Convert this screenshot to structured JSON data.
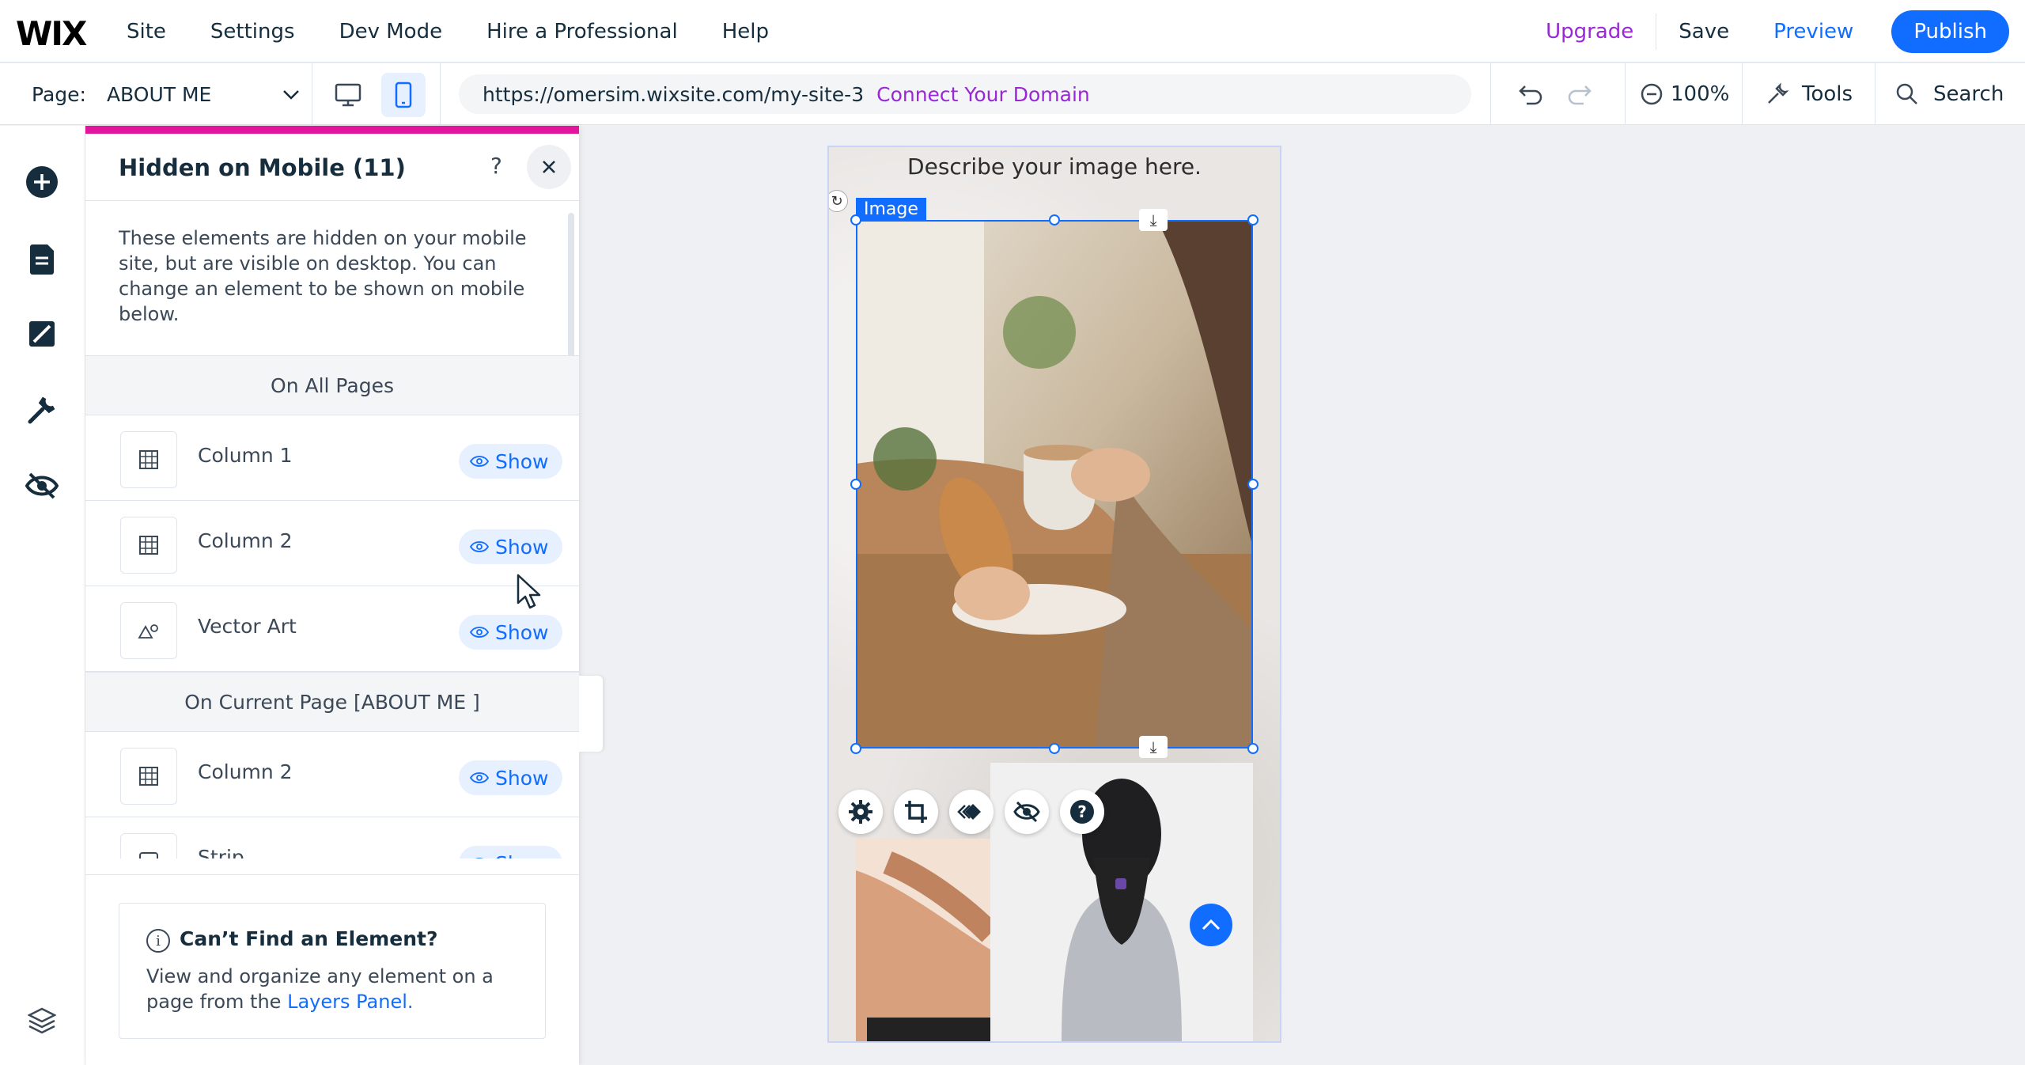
{
  "topbar": {
    "logo": "WIX",
    "menu": [
      "Site",
      "Settings",
      "Dev Mode",
      "Hire a Professional",
      "Help"
    ],
    "upgrade": "Upgrade",
    "save": "Save",
    "preview": "Preview",
    "publish": "Publish"
  },
  "subbar": {
    "page_label": "Page:",
    "page_value": "ABOUT ME",
    "url": "https://omersim.wixsite.com/my-site-3",
    "connect": "Connect Your Domain",
    "zoom": "100%",
    "tools": "Tools",
    "search": "Search"
  },
  "panel": {
    "title": "Hidden on Mobile (11)",
    "help": "?",
    "description": "These elements are hidden on your mobile site, but are visible on desktop. You can change an element to be shown on mobile below.",
    "section_all": "On All Pages",
    "section_current": "On Current Page [ABOUT ME ]",
    "show_label": "Show",
    "all_items": [
      {
        "name": "Column 1",
        "icon": "column-icon"
      },
      {
        "name": "Column 2",
        "icon": "column-icon"
      },
      {
        "name": "Vector Art",
        "icon": "vector-art-icon"
      }
    ],
    "current_items": [
      {
        "name": "Column 2",
        "icon": "column-icon"
      },
      {
        "name": "Strip",
        "icon": "strip-icon"
      }
    ],
    "footer_title": "Can’t Find an Element?",
    "footer_text": "View and organize any element on a page from the",
    "footer_link": "Layers Panel."
  },
  "canvas": {
    "caption": "Describe your image here.",
    "image_tag": "Image"
  },
  "colors": {
    "accent": "#116dff",
    "upgrade": "#9a27d5",
    "panel_top": "#e3159d"
  }
}
